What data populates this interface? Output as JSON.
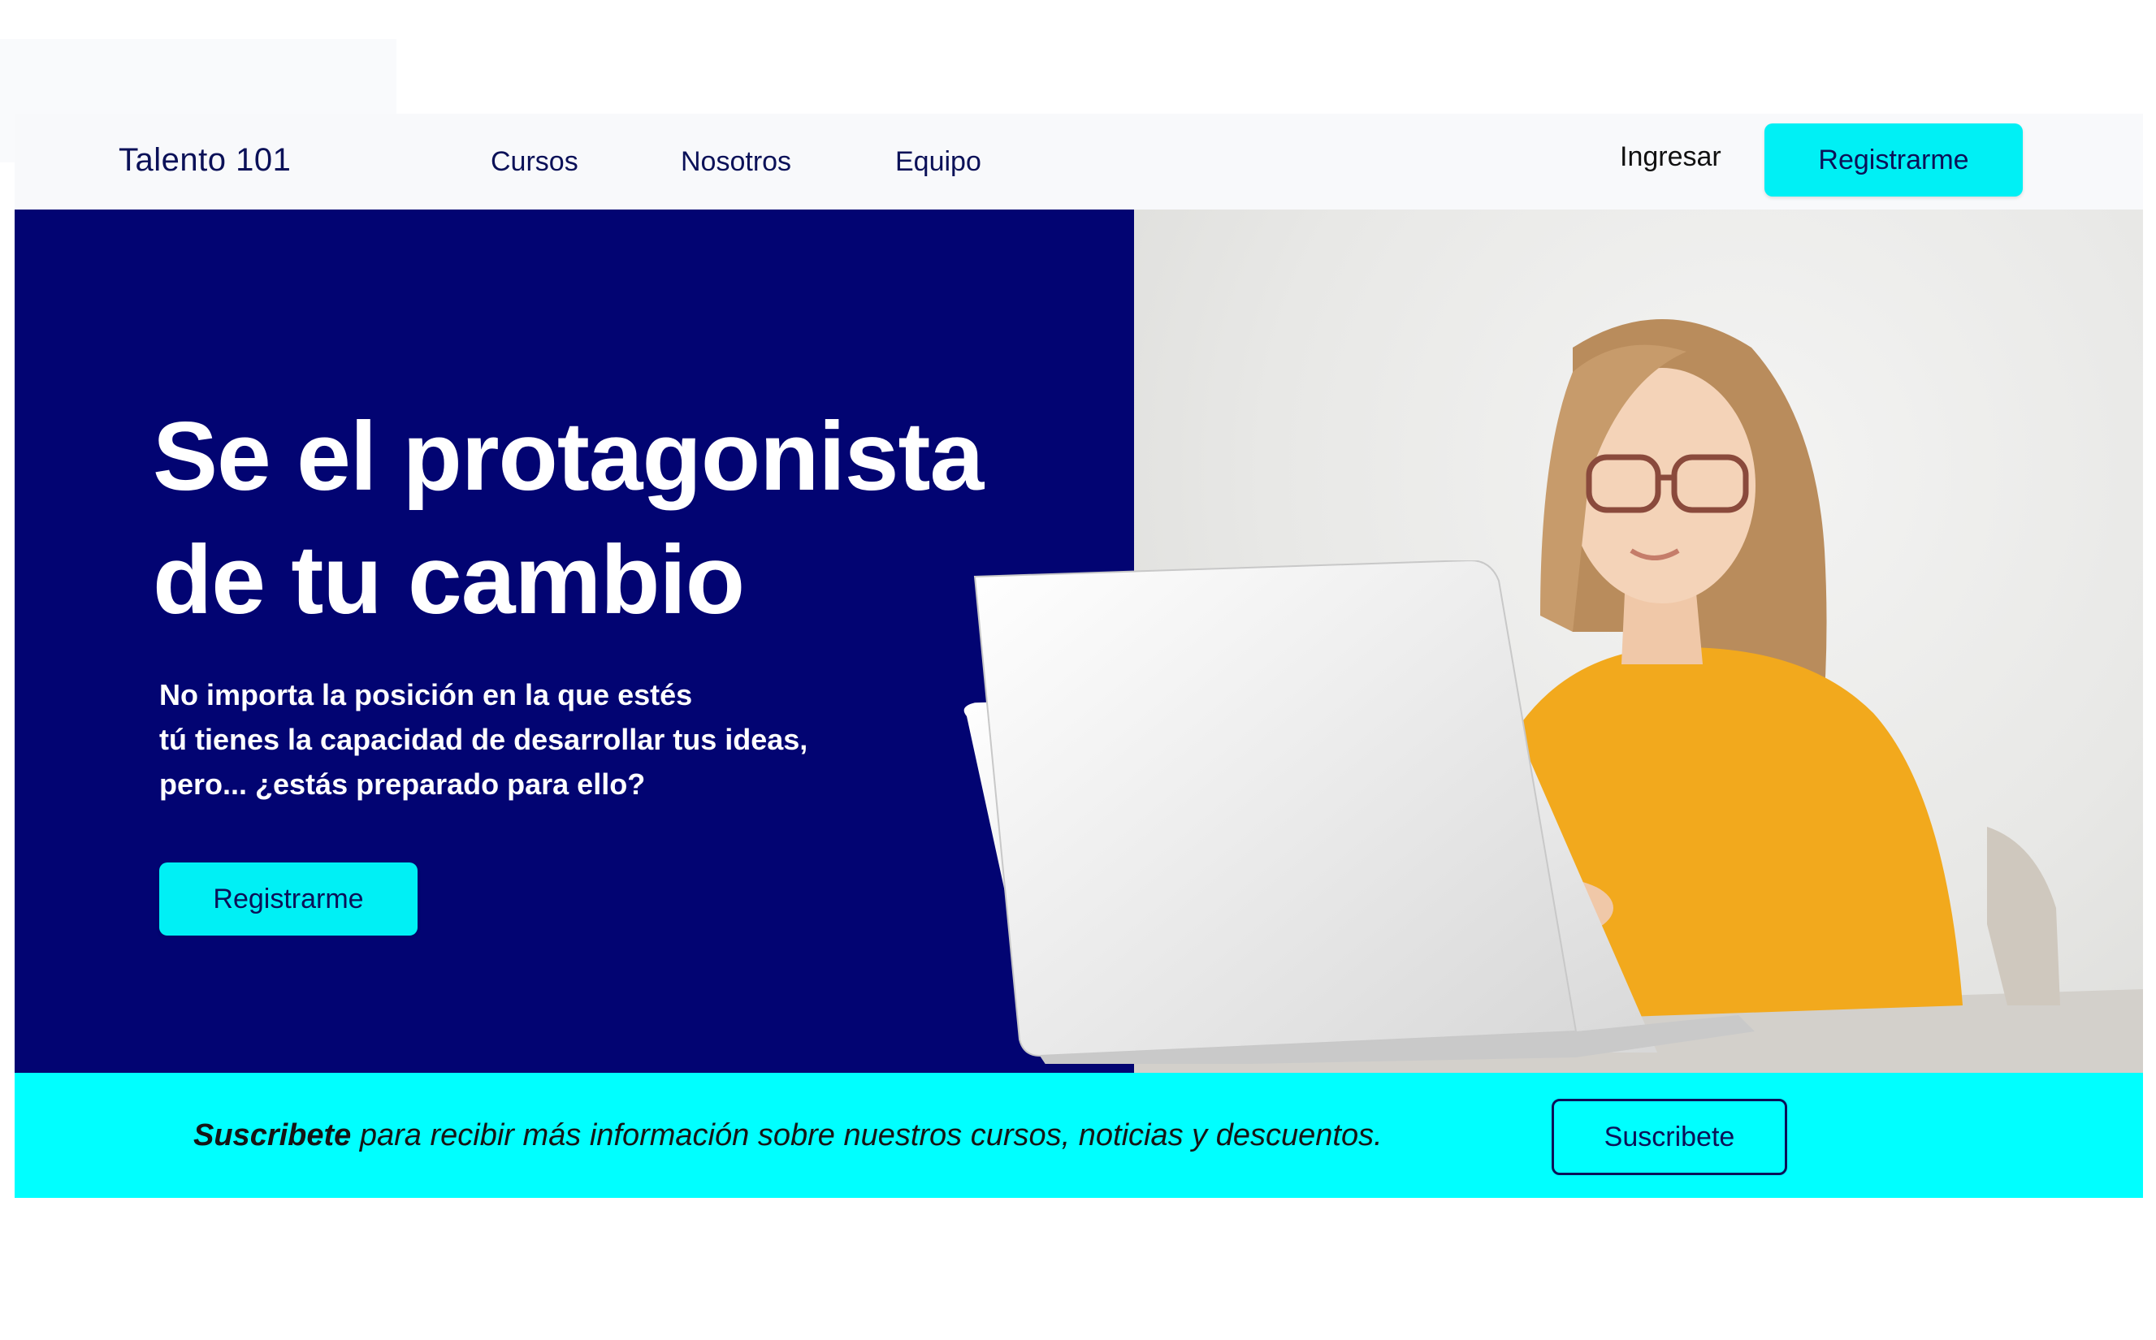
{
  "header": {
    "brand": "Talento 101",
    "nav": [
      {
        "label": "Cursos"
      },
      {
        "label": "Nosotros"
      },
      {
        "label": "Equipo"
      }
    ],
    "login_label": "Ingresar",
    "register_label": "Registrarme"
  },
  "hero": {
    "title_lines": [
      "Se el protagonista",
      "de tu cambio"
    ],
    "subtitle_lines": [
      "No importa la posición en la que estés",
      "tú tienes la capacidad de desarrollar tus ideas,",
      "pero... ¿estás preparado para ello?"
    ],
    "cta_label": "Registrarme",
    "image_icon": "woman-with-laptop-photo"
  },
  "subscribe": {
    "lead": "Suscribete",
    "text": " para recibir más información sobre nuestros cursos, noticias y descuentos.",
    "button_label": "Suscribete"
  },
  "colors": {
    "navy": "#020472",
    "cyan": "#00ffff",
    "button_cyan": "#00f0f5",
    "dark_text": "#0b1158"
  }
}
